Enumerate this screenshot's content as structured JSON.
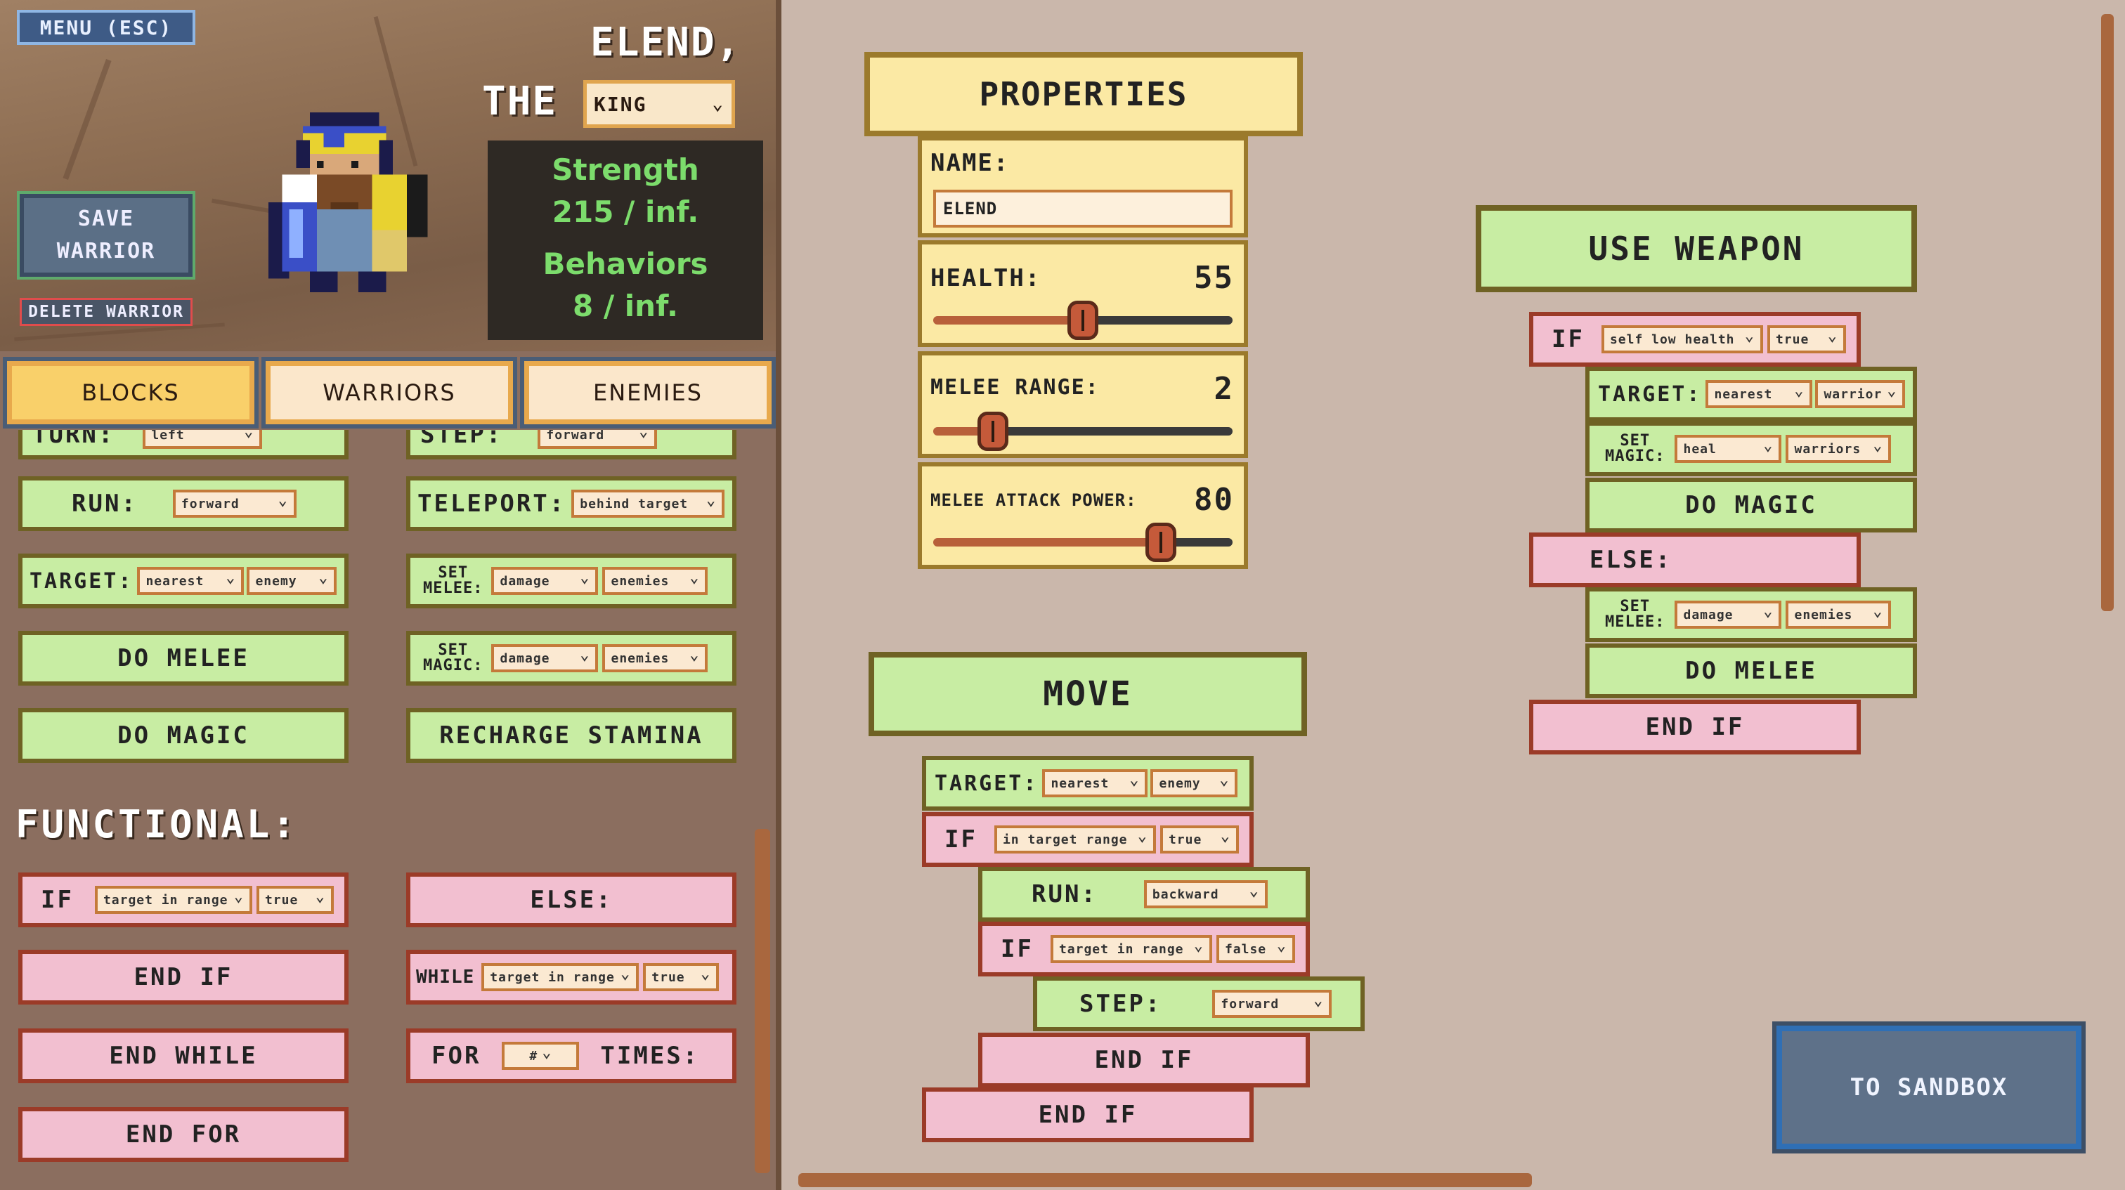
{
  "header": {
    "menu_label": "MENU (ESC)",
    "save_label_1": "SAVE",
    "save_label_2": "WARRIOR",
    "delete_label": "DELETE WARRIOR",
    "warrior_name": "ELEND,",
    "the_label": "THE",
    "title_value": "KING",
    "stats": {
      "strength_label": "Strength",
      "strength_value": "215 / inf.",
      "behaviors_label": "Behaviors",
      "behaviors_value": "8 / inf."
    }
  },
  "tabs": [
    {
      "label": "BLOCKS",
      "active": true
    },
    {
      "label": "WARRIORS",
      "active": false
    },
    {
      "label": "ENEMIES",
      "active": false
    }
  ],
  "palette": {
    "turn_label": "TURN:",
    "turn_dd": "left",
    "step_label": "STEP:",
    "step_dd": "forward",
    "run_label": "RUN:",
    "run_dd": "forward",
    "teleport_label": "TELEPORT:",
    "teleport_dd": "behind target",
    "target_label": "TARGET:",
    "target_dd1": "nearest",
    "target_dd2": "enemy",
    "set_melee_label_1": "SET",
    "set_melee_label_2": "MELEE:",
    "set_melee_dd1": "damage",
    "set_melee_dd2": "enemies",
    "set_magic_label_1": "SET",
    "set_magic_label_2": "MAGIC:",
    "set_magic_dd1": "damage",
    "set_magic_dd2": "enemies",
    "do_melee": "DO MELEE",
    "do_magic": "DO MAGIC",
    "recharge": "RECHARGE STAMINA",
    "functional_title": "FUNCTIONAL:",
    "if_label": "IF",
    "if_dd1": "target in range",
    "if_dd2": "true",
    "else_label": "ELSE:",
    "end_if": "END IF",
    "while_label": "WHILE",
    "while_dd1": "target in range",
    "while_dd2": "true",
    "end_while": "END WHILE",
    "for_label": "FOR",
    "for_placeholder": "#",
    "times_label": "TIMES:",
    "end_for": "END FOR"
  },
  "properties": {
    "title": "PROPERTIES",
    "name_label": "NAME:",
    "name_value": "ELEND",
    "health_label": "HEALTH:",
    "health_value": "55",
    "health_pct": 0.5,
    "melee_range_label": "MELEE RANGE:",
    "melee_range_value": "2",
    "melee_range_pct": 0.2,
    "melee_power_label": "MELEE ATTACK POWER:",
    "melee_power_value": "80",
    "melee_power_pct": 0.76
  },
  "move_block": {
    "title": "MOVE",
    "target_label": "TARGET:",
    "target_dd1": "nearest",
    "target_dd2": "enemy",
    "if1_label": "IF",
    "if1_dd1": "in target range",
    "if1_dd2": "true",
    "run_label": "RUN:",
    "run_dd": "backward",
    "if2_label": "IF",
    "if2_dd1": "target in range",
    "if2_dd2": "false",
    "step_label": "STEP:",
    "step_dd": "forward",
    "end_if_1": "END IF",
    "end_if_2": "END IF"
  },
  "weapon_block": {
    "title": "USE WEAPON",
    "if_label": "IF",
    "if_dd1": "self low health",
    "if_dd2": "true",
    "target_label": "TARGET:",
    "target_dd1": "nearest",
    "target_dd2": "warrior",
    "set_magic_1": "SET",
    "set_magic_2": "MAGIC:",
    "set_magic_dd1": "heal",
    "set_magic_dd2": "warriors",
    "do_magic": "DO MAGIC",
    "else_label": "ELSE:",
    "set_melee_1": "SET",
    "set_melee_2": "MELEE:",
    "set_melee_dd1": "damage",
    "set_melee_dd2": "enemies",
    "do_melee": "DO MELEE",
    "end_if": "END IF"
  },
  "sandbox_label": "TO SANDBOX"
}
